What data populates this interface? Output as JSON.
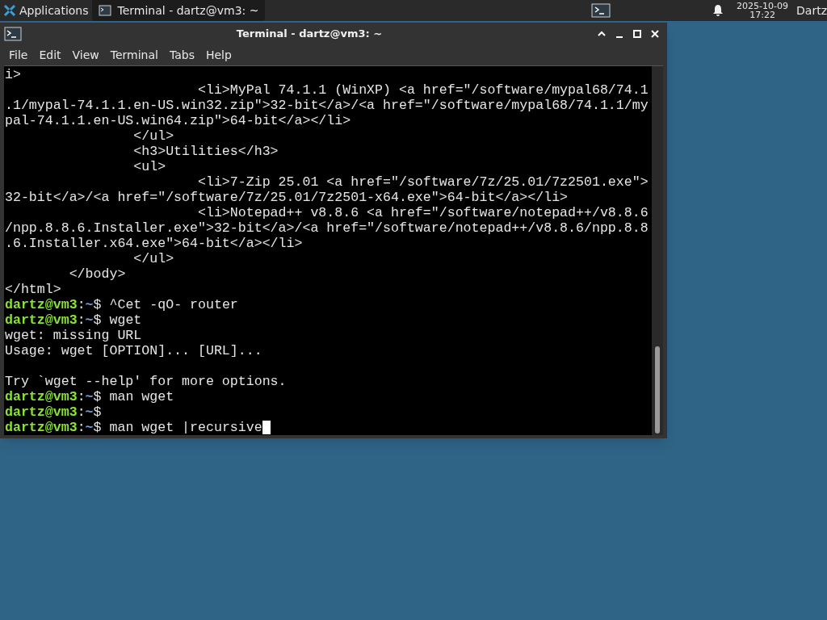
{
  "panel": {
    "menu_label": "Applications",
    "tasks": [
      {
        "label": "Terminal - dartz@vm3: ~",
        "selected": true
      }
    ],
    "date": "2025-10-09",
    "time": "17:22",
    "user": "Dartz"
  },
  "window": {
    "title": "Terminal - dartz@vm3: ~"
  },
  "menu": [
    "File",
    "Edit",
    "View",
    "Terminal",
    "Tabs",
    "Help"
  ],
  "lines": [
    {
      "kind": "output",
      "text": "i>"
    },
    {
      "kind": "output",
      "text": "                        <li>MyPal 74.1.1 (WinXP) <a href=\"/software/mypal68/74.1"
    },
    {
      "kind": "output",
      "text": ".1/mypal-74.1.1.en-US.win32.zip\">32-bit</a>/<a href=\"/software/mypal68/74.1.1/my"
    },
    {
      "kind": "output",
      "text": "pal-74.1.1.en-US.win64.zip\">64-bit</a></li>"
    },
    {
      "kind": "output",
      "text": "                </ul>"
    },
    {
      "kind": "output",
      "text": "                <h3>Utilities</h3>"
    },
    {
      "kind": "output",
      "text": "                <ul>"
    },
    {
      "kind": "output",
      "text": "                        <li>7-Zip 25.01 <a href=\"/software/7z/25.01/7z2501.exe\">"
    },
    {
      "kind": "output",
      "text": "32-bit</a>/<a href=\"/software/7z/25.01/7z2501-x64.exe\">64-bit</a></li>"
    },
    {
      "kind": "output",
      "text": "                        <li>Notepad++ v8.8.6 <a href=\"/software/notepad++/v8.8.6"
    },
    {
      "kind": "output",
      "text": "/npp.8.8.6.Installer.exe\">32-bit</a>/<a href=\"/software/notepad++/v8.8.6/npp.8.8"
    },
    {
      "kind": "output",
      "text": ".6.Installer.x64.exe\">64-bit</a></li>"
    },
    {
      "kind": "output",
      "text": "                </ul>"
    },
    {
      "kind": "output",
      "text": "        </body>"
    },
    {
      "kind": "output",
      "text": "</html>"
    },
    {
      "kind": "prompt",
      "user": "dartz@vm3",
      "separator": ":",
      "path": "~",
      "symbol": "$",
      "command": "^Cet -qO- router"
    },
    {
      "kind": "prompt",
      "user": "dartz@vm3",
      "separator": ":",
      "path": "~",
      "symbol": "$",
      "command": "wget"
    },
    {
      "kind": "output",
      "text": "wget: missing URL"
    },
    {
      "kind": "output",
      "text": "Usage: wget [OPTION]... [URL]..."
    },
    {
      "kind": "blank"
    },
    {
      "kind": "output",
      "text": "Try `wget --help' for more options."
    },
    {
      "kind": "prompt",
      "user": "dartz@vm3",
      "separator": ":",
      "path": "~",
      "symbol": "$",
      "command": "man wget"
    },
    {
      "kind": "prompt",
      "user": "dartz@vm3",
      "separator": ":",
      "path": "~",
      "symbol": "$"
    },
    {
      "kind": "prompt",
      "user": "dartz@vm3",
      "separator": ":",
      "path": "~",
      "symbol": "$",
      "command": "man wget |recursive",
      "cursor": true
    }
  ]
}
